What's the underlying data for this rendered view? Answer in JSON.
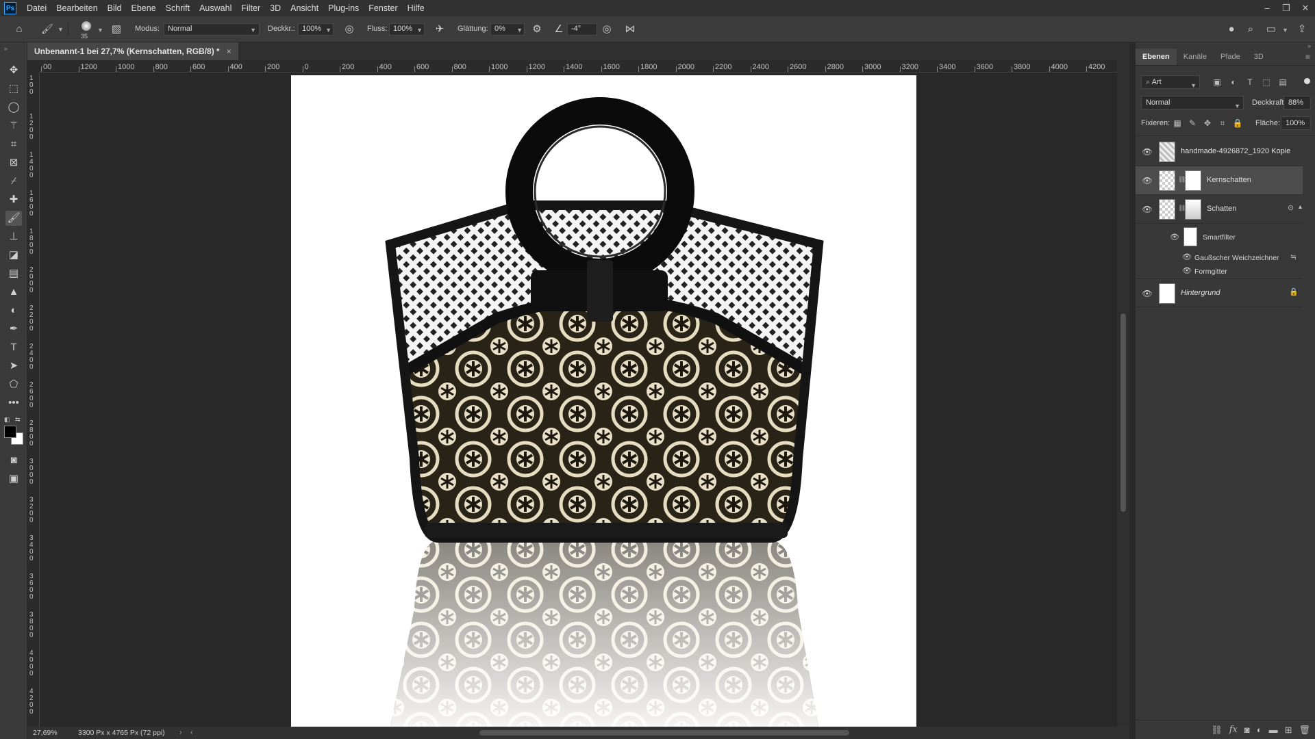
{
  "menu": {
    "app_badge": "Ps",
    "items": [
      "Datei",
      "Bearbeiten",
      "Bild",
      "Ebene",
      "Schrift",
      "Auswahl",
      "Filter",
      "3D",
      "Ansicht",
      "Plug-ins",
      "Fenster",
      "Hilfe"
    ]
  },
  "window_controls": {
    "minimize": "–",
    "restore": "❐",
    "close": "✕"
  },
  "options": {
    "brush_size": "35",
    "mode_label": "Modus:",
    "mode_value": "Normal",
    "opacity_label": "Deckkr.:",
    "opacity_value": "100%",
    "flow_label": "Fluss:",
    "flow_value": "100%",
    "smoothing_label": "Glättung:",
    "smoothing_value": "0%",
    "angle_value": "-4°"
  },
  "document": {
    "tab_title": "Unbenannt-1 bei 27,7% (Kernschatten, RGB/8) *",
    "close": "×"
  },
  "ruler_h": [
    "00",
    "1200",
    "1000",
    "800",
    "600",
    "400",
    "200",
    "0",
    "200",
    "400",
    "600",
    "800",
    "1000",
    "1200",
    "1400",
    "1600",
    "1800",
    "2000",
    "2200",
    "2400",
    "2600",
    "2800",
    "3000",
    "3200",
    "3400",
    "3600",
    "3800",
    "4000",
    "4200"
  ],
  "ruler_v": [
    "1 0 0",
    "1 2 0 0",
    "1 4 0 0",
    "1 6 0 0",
    "1 8 0 0",
    "2 0 0 0",
    "2 2 0 0",
    "2 4 0 0",
    "2 6 0 0",
    "2 8 0 0",
    "3 0 0 0",
    "3 2 0 0",
    "3 4 0 0",
    "3 6 0 0",
    "3 8 0 0",
    "4 0 0 0",
    "4 2 0 0"
  ],
  "status": {
    "zoom": "27,69%",
    "doc_info": "3300 Px x 4765 Px (72 ppi)"
  },
  "layers_panel": {
    "tabs": [
      "Ebenen",
      "Kanäle",
      "Pfade",
      "3D"
    ],
    "filter_kind": "Art",
    "blend_mode": "Normal",
    "opacity_label": "Deckkraft:",
    "opacity_value": "88%",
    "lock_label": "Fixieren:",
    "fill_label": "Fläche:",
    "fill_value": "100%",
    "layers": [
      {
        "name": "handmade-4926872_1920 Kopie"
      },
      {
        "name": "Kernschatten"
      },
      {
        "name": "Schatten"
      }
    ],
    "smart_filter_label": "Smartfilter",
    "smart_filters": [
      "Gaußscher Weichzeichner",
      "Formgitter"
    ],
    "background_name": "Hintergrund"
  },
  "colors": {
    "menubar": "#323232",
    "panel": "#383838",
    "canvas_bg": "#282828",
    "selected_layer": "#4d4d4d"
  }
}
